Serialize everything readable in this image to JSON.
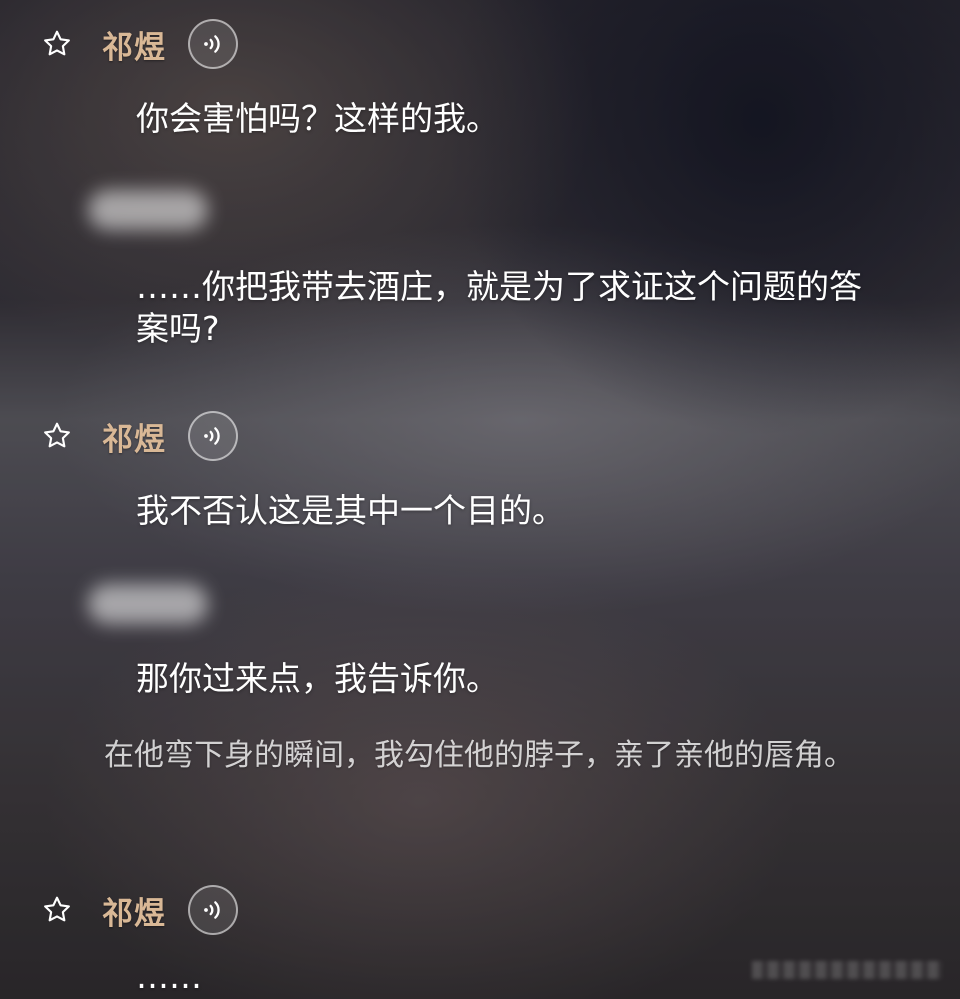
{
  "speaker": {
    "name": "祁煜"
  },
  "messages": [
    "你会害怕吗？这样的我。",
    "……你把我带去酒庄，就是为了求证这个问题的答案吗?",
    "我不否认这是其中一个目的。",
    "那你过来点，我告诉你。",
    "……"
  ],
  "narration": [
    "在他弯下身的瞬间，我勾住他的脖子，亲了亲他的唇角。"
  ],
  "colors": {
    "speaker_name": "#d9b896",
    "message_text": "#ffffff",
    "narration_text": "#c8c6c8"
  },
  "icons": {
    "favorite": "star-outline-icon",
    "voice": "voice-wave-icon"
  }
}
